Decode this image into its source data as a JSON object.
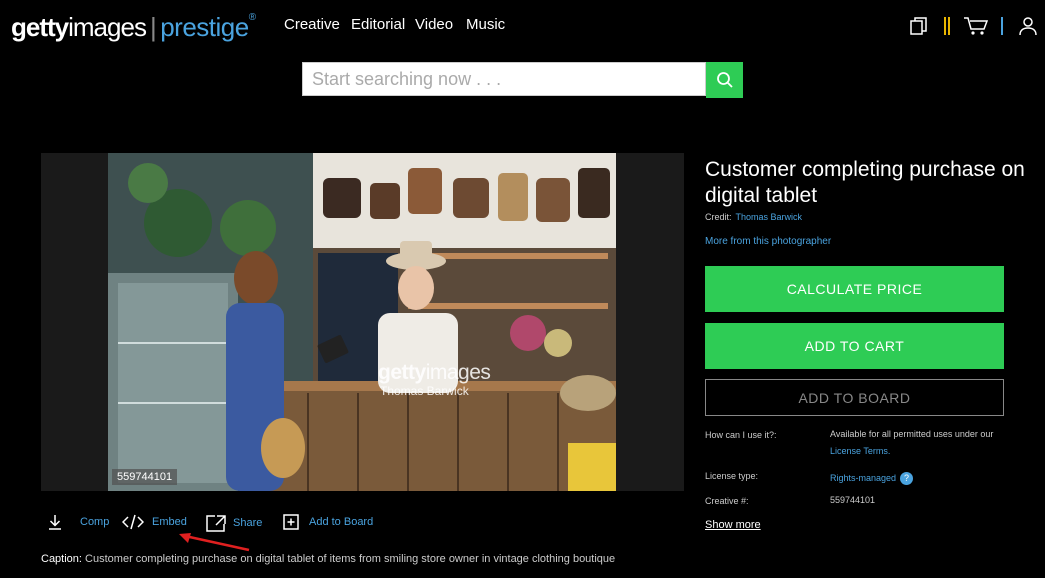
{
  "header": {
    "logo": {
      "getty": "getty",
      "images": "images",
      "divider": "|",
      "sub": "prestige",
      "reg": "®"
    },
    "nav": [
      "Creative",
      "Editorial",
      "Video",
      "Music"
    ],
    "icons": [
      "boards-icon",
      "cart-icon",
      "account-icon"
    ],
    "accent_bar_color": "#e8b500"
  },
  "search": {
    "placeholder": "Start searching now . . ."
  },
  "image": {
    "watermark_brand": "getty",
    "watermark_brand_light": "images",
    "watermark_photographer": "Thomas Barwick",
    "id_badge": "559744101"
  },
  "actions": {
    "comp": "Comp",
    "embed": "Embed",
    "share": "Share",
    "add_to_board": "Add to Board"
  },
  "caption": {
    "label": "Caption:",
    "text": "Customer completing purchase on digital tablet of items from smiling store owner in vintage clothing boutique"
  },
  "details": {
    "title": "Customer completing purchase on digital tablet",
    "credit_label": "Credit:",
    "credit_value": "Thomas Barwick",
    "more_link": "More from this photographer",
    "calculate_price": "CALCULATE PRICE",
    "add_to_cart": "ADD TO CART",
    "add_to_board": "ADD TO BOARD",
    "usage_label": "How can I use it?:",
    "usage_value": "Available for all permitted uses under our",
    "license_terms": "License Terms.",
    "license_type_label": "License type:",
    "license_type_value": "Rights-managed",
    "creative_label": "Creative #:",
    "creative_value": "559744101",
    "show_more": "Show more"
  },
  "colors": {
    "accent_green": "#2ecc55",
    "link_blue": "#4aa3df",
    "annotation_red": "#e02020"
  }
}
